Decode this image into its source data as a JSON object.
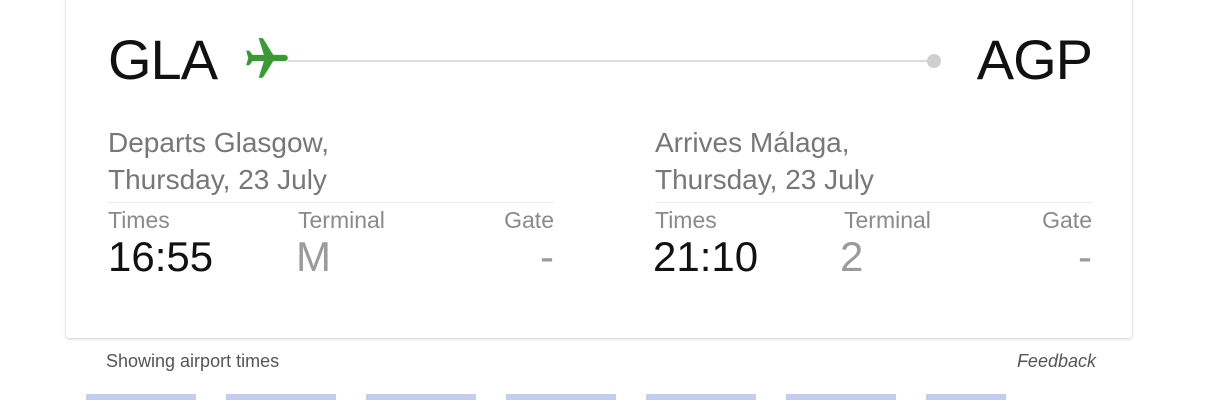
{
  "route": {
    "departure_code": "GLA",
    "arrival_code": "AGP"
  },
  "departure": {
    "place": "Departs Glasgow,",
    "date": "Thursday, 23 July",
    "labels": {
      "times": "Times",
      "terminal": "Terminal",
      "gate": "Gate"
    },
    "time": "16:55",
    "terminal": "M",
    "gate": "-"
  },
  "arrival": {
    "place": "Arrives Málaga,",
    "date": "Thursday, 23 July",
    "labels": {
      "times": "Times",
      "terminal": "Terminal",
      "gate": "Gate"
    },
    "time": "21:10",
    "terminal": "2",
    "gate": "-"
  },
  "footer": {
    "note": "Showing airport times",
    "feedback": "Feedback"
  },
  "colors": {
    "plane": "#3a9b35",
    "primary_text": "#111111",
    "secondary_text": "#777777",
    "muted_value": "#9b9b9b"
  },
  "icons": {
    "plane": "airplane-icon",
    "route_end": "destination-dot-icon"
  }
}
